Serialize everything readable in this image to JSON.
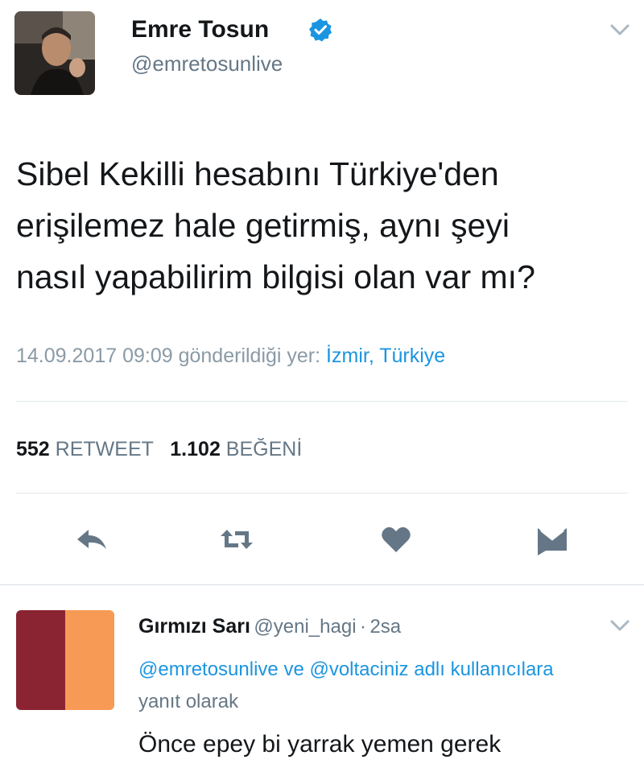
{
  "tweet": {
    "author_name": "Emre Tosun",
    "author_handle": "@emretosunlive",
    "text_lines": [
      "Sibel Kekilli hesabını Türkiye'den",
      "erişilemez hale getirmiş, aynı şeyi",
      "nasıl yapabilirim bilgisi olan var mı?"
    ],
    "timestamp": "14.09.2017 09:09",
    "sent_from_label": "gönderildiği yer:",
    "location": "İzmir, Türkiye",
    "retweet_count": "552",
    "retweet_label": "RETWEET",
    "like_count": "1.102",
    "like_label": "BEĞENİ"
  },
  "icons": {
    "verified": "verified-badge-icon",
    "reply": "reply-icon",
    "retweet": "retweet-icon",
    "like": "heart-icon",
    "dm": "envelope-icon",
    "menu": "chevron-down-icon"
  },
  "reply": {
    "author_name": "Gırmızı Sarı",
    "author_handle": "@yeni_hagi",
    "separator": "·",
    "time": "2sa",
    "replying_mention_1": "@emretosunlive",
    "replying_and": "ve",
    "replying_mention_2": "@voltaciniz",
    "replying_suffix_link": "adlı kullanıcılara",
    "replying_suffix": "yanıt olarak",
    "text": "Önce epey bi yarrak yemen gerek"
  },
  "colors": {
    "brand_blue": "#1b95e0",
    "action_gray": "#657786",
    "reply_avatar_red": "#8b2432",
    "reply_avatar_orange": "#f79a56"
  }
}
